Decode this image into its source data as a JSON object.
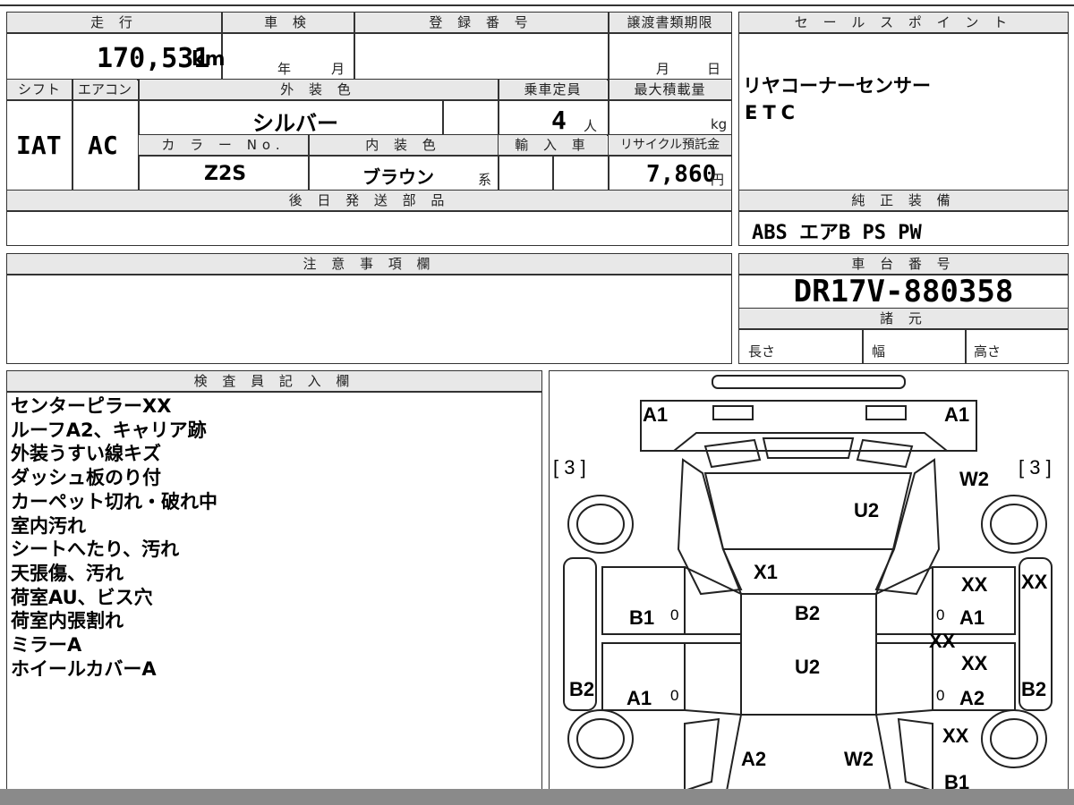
{
  "headers": {
    "mileage": "走 行",
    "inspection": "車 検",
    "registration_no": "登 録 番 号",
    "transfer_deadline": "譲渡書類期限",
    "sales_point": "セ ー ル ス ポ イ ン ト",
    "shift": "シフト",
    "aircon": "エアコン",
    "exterior_color": "外 装 色",
    "capacity": "乗車定員",
    "max_load": "最大積載量",
    "color_no": "カ ラ ー No.",
    "interior_color": "内 装 色",
    "import_car": "輸 入 車",
    "recycle_fee": "リサイクル預託金",
    "later_parts": "後 日 発 送 部 品",
    "genuine_equipment": "純 正 装 備",
    "notes": "注 意 事 項 欄",
    "chassis_no": "車 台 番 号",
    "specs": "諸 元",
    "inspector_notes": "検 査 員 記 入 欄"
  },
  "values": {
    "mileage": "170,531",
    "mileage_unit": "km",
    "year_unit": "年",
    "month_unit": "月",
    "deadline_month": "月",
    "deadline_day": "日",
    "shift": "IAT",
    "aircon": "AC",
    "exterior_color": "シルバー",
    "capacity": "4",
    "capacity_unit": "人",
    "max_load_unit": "kg",
    "color_no": "Z2S",
    "interior_color": "ブラウン",
    "interior_suffix": "系",
    "recycle_fee": "7,860",
    "yen_unit": "円",
    "sales_point_1": "リヤコーナーセンサー",
    "sales_point_2": "ETC",
    "genuine_equipment": "ABS エアB PS PW",
    "chassis_no": "DR17V-880358",
    "length": "長さ",
    "width": "幅",
    "height": "高さ"
  },
  "inspector_notes": [
    "センターピラーXX",
    "ルーフA2、キャリア跡",
    "外装うすい線キズ",
    "ダッシュ板のり付",
    "カーペット切れ・破れ中",
    "室内汚れ",
    "シートへたり、汚れ",
    "天張傷、汚れ",
    "荷室AU、ビス穴",
    "荷室内張割れ",
    "ミラーA",
    "ホイールカバーA"
  ],
  "diagram_labels": {
    "a1_left": "A1",
    "a1_right": "A1",
    "bracket_left": "[ 3 ]",
    "bracket_right": "[ 3 ]",
    "w2_front_right": "W2",
    "u2_hood": "U2",
    "x1_windshield": "X1",
    "b2_roof": "B2",
    "u2_roof": "U2",
    "b1_left_door": "B1",
    "a1_left_rear": "A1",
    "b2_left_side": "B2",
    "xx_right_1": "XX",
    "xx_right_side": "XX",
    "a1_right_door": "A1",
    "xx_right_2": "XX",
    "xx_right_3": "XX",
    "a2_right_rear": "A2",
    "b2_right_side": "B2",
    "xx_right_4": "XX",
    "a2_bottom": "A2",
    "w2_bottom": "W2",
    "b1_bottom": "B1",
    "zero_1": "0",
    "zero_2": "0",
    "zero_3": "0",
    "zero_4": "0"
  }
}
